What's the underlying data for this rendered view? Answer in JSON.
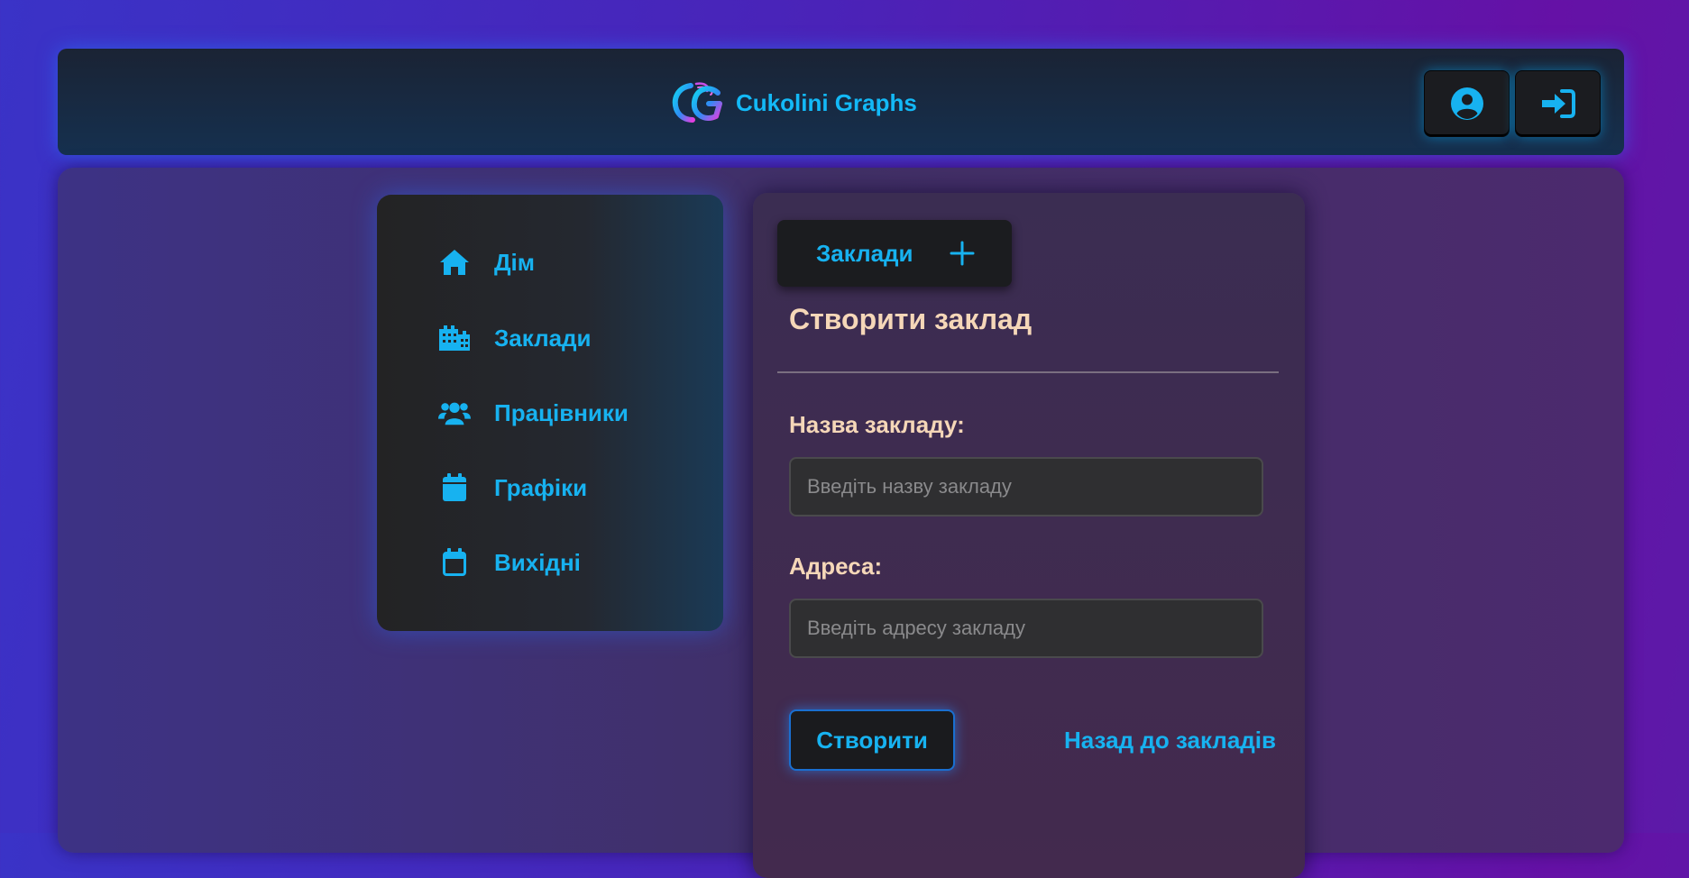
{
  "header": {
    "brand_name": "Cukolini Graphs",
    "logo_letter": "G",
    "profile_icon": "user-circle-icon",
    "login_icon": "sign-in-icon"
  },
  "sidebar": {
    "items": [
      {
        "label": "Дім",
        "icon": "home-icon"
      },
      {
        "label": "Заклади",
        "icon": "buildings-icon"
      },
      {
        "label": "Працівники",
        "icon": "users-icon"
      },
      {
        "label": "Графіки",
        "icon": "calendar-filled-icon"
      },
      {
        "label": "Вихідні",
        "icon": "calendar-outline-icon"
      }
    ]
  },
  "panel": {
    "tab_label": "Заклади",
    "tab_icon": "plus-icon",
    "title": "Створити заклад",
    "name_label": "Назва закладу:",
    "name_placeholder": "Введіть назву закладу",
    "name_value": "",
    "address_label": "Адреса:",
    "address_placeholder": "Введіть адресу закладу",
    "address_value": "",
    "submit_label": "Створити",
    "back_link": "Назад до закладів"
  },
  "colors": {
    "accent": "#17b2f0",
    "heading": "#f5d7b8",
    "dark_surface": "#1b1c1f",
    "bg_left": "#3a33c7",
    "bg_right": "#6511a6"
  }
}
